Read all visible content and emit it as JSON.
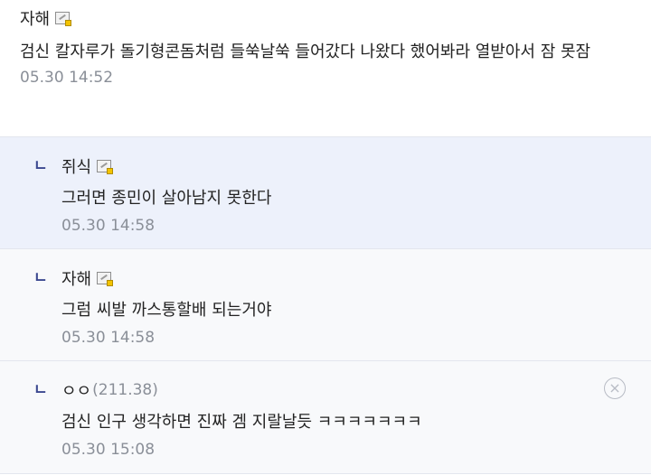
{
  "comments": [
    {
      "nick": "자해",
      "text": "검신 칼자루가 돌기형콘돔처럼 들쑥날쑥 들어갔다 나왔다 했어봐라 열받아서 잠 못잠",
      "time": "05.30 14:52"
    }
  ],
  "replies": [
    {
      "nick": "쥐식",
      "text": "그러면 종민이 살아남지 못한다",
      "time": "05.30 14:58"
    },
    {
      "nick": "자해",
      "text": "그럼 씨발 까스통할배 되는거야",
      "time": "05.30 14:58"
    },
    {
      "nick": "ㅇㅇ",
      "ip": "(211.38)",
      "text": "검신 인구 생각하면 진짜 겜 지랄날듯 ㅋㅋㅋㅋㅋㅋㅋ",
      "time": "05.30 15:08"
    }
  ],
  "reply_arrow": "ㄴ",
  "delete_icon": "×",
  "icons": {
    "badge": "gallog-badge-icon",
    "delete": "close-circle-icon"
  }
}
